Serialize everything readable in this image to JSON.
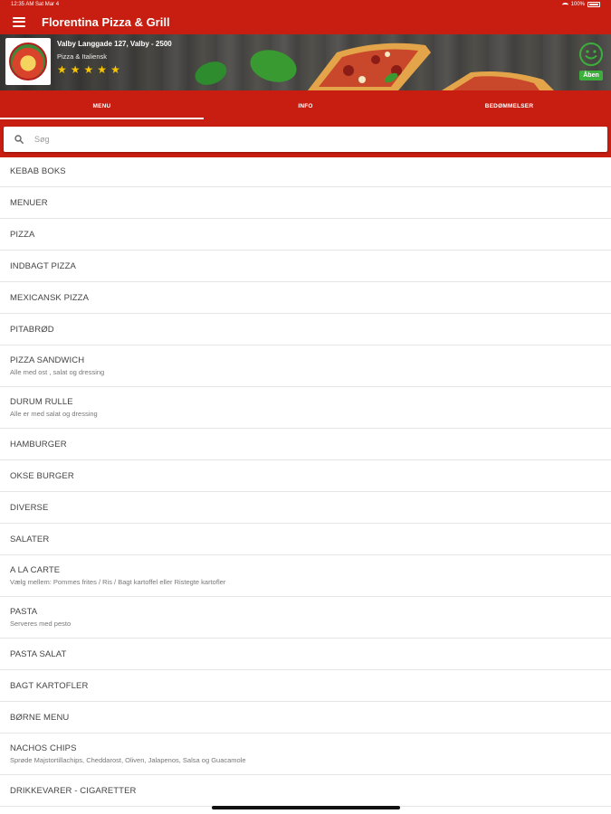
{
  "statusbar": {
    "time": "12:35 AM",
    "date": "Sat Mar 4",
    "battery": "100%"
  },
  "appbar": {
    "title": "Florentina Pizza & Grill",
    "menu_icon": "hamburger-icon"
  },
  "restaurant": {
    "address": "Valby Langgade 127, Valby - 2500",
    "cuisine": "Pizza & Italiensk",
    "rating": 5,
    "stars": [
      "★",
      "★",
      "★",
      "★",
      "★"
    ],
    "status": "Åben",
    "status_color": "#3cae3c"
  },
  "tabs": [
    {
      "label": "MENU",
      "active": true
    },
    {
      "label": "INFO",
      "active": false
    },
    {
      "label": "BEDØMMELSER",
      "active": false
    }
  ],
  "search": {
    "placeholder": "Søg",
    "value": ""
  },
  "colors": {
    "brand": "#c81d11",
    "star": "#f6c400"
  },
  "menu": [
    {
      "name": "KEBAB BOKS",
      "desc": ""
    },
    {
      "name": "MENUER",
      "desc": ""
    },
    {
      "name": "PIZZA",
      "desc": ""
    },
    {
      "name": "INDBAGT PIZZA",
      "desc": ""
    },
    {
      "name": "MEXICANSK PIZZA",
      "desc": ""
    },
    {
      "name": "PITABRØD",
      "desc": ""
    },
    {
      "name": "PIZZA SANDWICH",
      "desc": "Alle med ost , salat og dressing"
    },
    {
      "name": "DURUM RULLE",
      "desc": "Alle er med salat og dressing"
    },
    {
      "name": "HAMBURGER",
      "desc": ""
    },
    {
      "name": "OKSE BURGER",
      "desc": ""
    },
    {
      "name": "DIVERSE",
      "desc": ""
    },
    {
      "name": "SALATER",
      "desc": ""
    },
    {
      "name": "A LA CARTE",
      "desc": "Vælg mellem: Pommes frites / Ris / Bagt kartoffel eller Ristegte kartofler"
    },
    {
      "name": "PASTA",
      "desc": "Serveres med pesto"
    },
    {
      "name": "PASTA SALAT",
      "desc": ""
    },
    {
      "name": "BAGT KARTOFLER",
      "desc": ""
    },
    {
      "name": "BØRNE MENU",
      "desc": ""
    },
    {
      "name": "NACHOS CHIPS",
      "desc": "Sprøde Majstortillachips, Cheddarost, Oliven, Jalapenos, Salsa og Guacamole"
    },
    {
      "name": "DRIKKEVARER - CIGARETTER",
      "desc": ""
    }
  ]
}
